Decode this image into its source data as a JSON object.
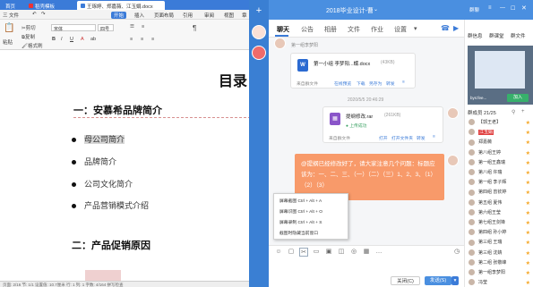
{
  "wps": {
    "tabs": [
      "首页",
      "稻壳模板",
      "王琢婷、郑嘉薇、江玉娟.docx"
    ],
    "menu": {
      "file": "三 文件",
      "items": [
        "开始",
        "插入",
        "页面布局",
        "引用",
        "审阅",
        "视图",
        "章"
      ],
      "selected": "开始"
    },
    "toolbar": {
      "cut": "剪切",
      "copy": "复制",
      "paste": "粘贴",
      "format_painter": "格式刷",
      "font_name": "宋体",
      "font_size": "四号",
      "bold": "B",
      "italic": "I",
      "underline": "U",
      "paragraph_mark": "¶"
    },
    "document": {
      "title": "目录",
      "heading1": "一：安慕希品牌简介",
      "bullets": [
        "母公司简介",
        "品牌简介",
        "公司文化简介",
        "产品营销模式介绍"
      ],
      "heading2": "二：产品促销原因"
    },
    "status": "页面: 2/16   节: 1/1   设置值: 10.7厘米   行: 1   列: 1   字数: 4/164   拼写检查"
  },
  "qq": {
    "title": "2018毕业设计-曹",
    "header_label": "群聊",
    "tabs": [
      "聊天",
      "公告",
      "相册",
      "文件",
      "作业",
      "设置"
    ],
    "tab_dropdown": "▾",
    "messages": {
      "sender1": "第一组李梦阳",
      "file1": {
        "name": "第一小组 李梦阳...蝶.docx",
        "size": "(43KB)",
        "source": "来自群文件",
        "actions": [
          "在线预览",
          "下载",
          "另存为",
          "转发"
        ]
      },
      "timestamp": "2020/5/5 20:46:29",
      "file2": {
        "name": "提纲修改.rar",
        "size": "(261KB)",
        "status": "上传成功",
        "source": "来自群文件",
        "actions": [
          "打开",
          "打开文件夹",
          "转发"
        ]
      },
      "notice": "@提纲已经修改好了，请大家注意几个问题：标题应该为：一、二、三、（一）（二）（三）1、2、3、（1）（2）（3）"
    },
    "context_menu": [
      "屏幕截图 Ctrl + Alt + A",
      "屏幕识图 Ctrl + Alt + O",
      "屏幕录制 Ctrl + Alt + S",
      "截图时隐藏当前窗口"
    ],
    "composer": {
      "close": "关闭(C)",
      "send": "发送(S)"
    }
  },
  "panel": {
    "actions": [
      "群信息",
      "群课堂",
      "群文件"
    ],
    "video_label": "bys:fee...",
    "join": "加入",
    "member_header": "群成员 21/25",
    "members": [
      "【郭王老】",
      "江玉娟",
      "郑嘉薇",
      "第八组王婷",
      "第一组王鑫瑞",
      "第八组 许瑞",
      "第一组 李子辉",
      "第四组 曾钦婷",
      "第五组 夏伟",
      "第六组王莹",
      "第七组王剑锋",
      "第四组 孙小婷",
      "第三组 王瑞",
      "第三组 沈婧",
      "第二组 张敬峰",
      "第一组李梦阳",
      "冯莹"
    ],
    "highlighted_member": "江玉娟"
  },
  "colors": {
    "wps_blue": "#3b7bd8",
    "qq_blue": "#4a8fe0",
    "notice_orange": "#f89a6a",
    "highlight_red": "#e04040"
  }
}
